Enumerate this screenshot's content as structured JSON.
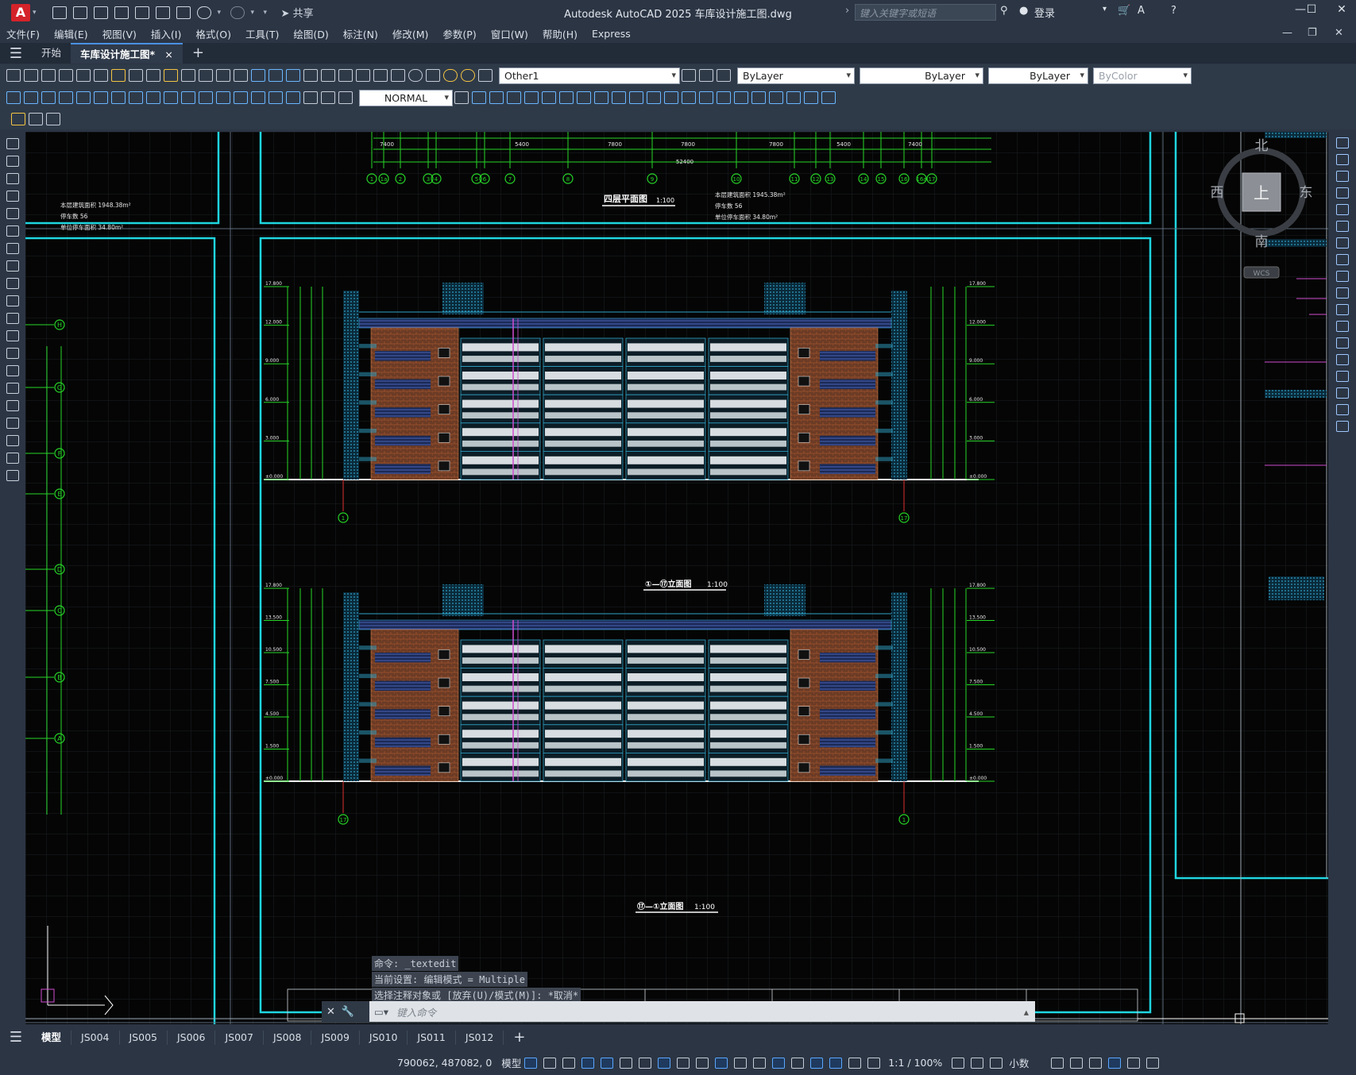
{
  "app": {
    "title": "Autodesk AutoCAD 2025    车库设计施工图.dwg",
    "share_label": "共享",
    "search_placeholder": "键入关键字或短语",
    "login_label": "登录",
    "logo_letter": "A"
  },
  "menu": [
    "文件(F)",
    "编辑(E)",
    "视图(V)",
    "插入(I)",
    "格式(O)",
    "工具(T)",
    "绘图(D)",
    "标注(N)",
    "修改(M)",
    "参数(P)",
    "窗口(W)",
    "帮助(H)",
    "Express"
  ],
  "doc_tabs": {
    "start": "开始",
    "active": "车库设计施工图*",
    "close": "×",
    "new": "+"
  },
  "properties": {
    "layer": "Other1",
    "color": "ByLayer",
    "linetype": "ByLayer",
    "lineweight": "ByLayer",
    "plotstyle": "ByColor",
    "textstyle": "NORMAL"
  },
  "viewcube": {
    "north": "北",
    "south": "南",
    "east": "东",
    "west": "西",
    "top": "上",
    "wcs": "WCS"
  },
  "drawing": {
    "plan_title": "四层平面图",
    "plan_scale": "1:100",
    "plan_info_left": [
      "本层建筑面积  1948.38m²",
      "停车数  56",
      "单位停车面积  34.80m²"
    ],
    "plan_info_right": [
      "本层建筑面积  1945.38m²",
      "停车数  56",
      "单位停车面积  34.80m²"
    ],
    "plan_total": "52400",
    "plan_dims": [
      "7400",
      "5400",
      "7800",
      "7800",
      "7800",
      "5400",
      "7400"
    ],
    "plan_axes": [
      "1",
      "1a",
      "2",
      "3",
      "4",
      "5",
      "6",
      "7",
      "8",
      "9",
      "10",
      "11",
      "12",
      "13",
      "14",
      "15",
      "16",
      "16a",
      "17"
    ],
    "elev1_title": "①—⑰立面图",
    "elev1_scale": "1:100",
    "elev2_title": "⑰—①立面图",
    "elev2_scale": "1:100",
    "elev1_axis_left": "1",
    "elev1_axis_right": "17",
    "elev2_axis_left": "17",
    "elev2_axis_right": "1",
    "elev_levels": [
      "17.800",
      "12.000",
      "9.000",
      "6.000",
      "3.000",
      "±0.000"
    ],
    "elev2_levels": [
      "17.800",
      "13.500",
      "10.500",
      "7.500",
      "4.500",
      "1.500",
      "±0.000"
    ],
    "side_axes": [
      "H",
      "G",
      "F",
      "E",
      "D",
      "C",
      "B",
      "A"
    ]
  },
  "command": {
    "history": [
      "命令: _textedit",
      "当前设置: 编辑模式 = Multiple",
      "选择注释对象或 [放弃(U)/模式(M)]: *取消*"
    ],
    "placeholder": "键入命令"
  },
  "layout_tabs": {
    "model": "模型",
    "sheets": [
      "JS004",
      "JS005",
      "JS006",
      "JS007",
      "JS008",
      "JS009",
      "JS010",
      "JS011",
      "JS012"
    ],
    "add": "+"
  },
  "status": {
    "coords": "790062, 487082, 0",
    "space": "模型",
    "scale": "1:1 / 100%",
    "units": "小数"
  }
}
